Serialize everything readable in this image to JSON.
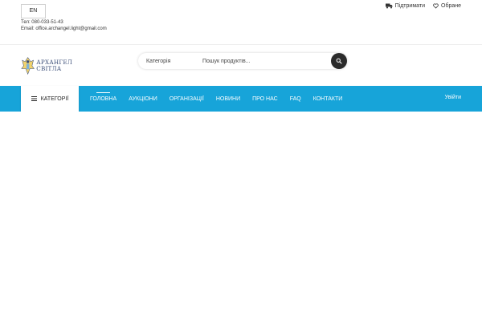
{
  "topbar": {
    "lang_button": "EN",
    "phone": "Тел: 080-033-51-43",
    "email": "Email: office.archangel.light@gmail.com",
    "support_label": "Підтримати",
    "favorites_label": "Обране"
  },
  "header": {
    "logo_line1": "АРХАНГЕЛ",
    "logo_line2": "СВІТЛА",
    "search": {
      "category_label": "Категорія",
      "placeholder": "Пошук продуктів..."
    }
  },
  "nav": {
    "categories_label": "КАТЕГОРІЇ",
    "items": [
      {
        "label": "ГОЛОВНА"
      },
      {
        "label": "АУКЦІОНИ"
      },
      {
        "label": "ОРГАНІЗАЦІЇ"
      },
      {
        "label": "НОВИНИ"
      },
      {
        "label": "ПРО НАС"
      },
      {
        "label": "FAQ"
      },
      {
        "label": "КОНТАКТИ"
      }
    ],
    "login_label": "Увійти"
  },
  "colors": {
    "nav_background": "#17a4d9",
    "logo_text": "#3b4e78",
    "search_button": "#2b2b2b"
  },
  "icons": {
    "support": "truck-icon",
    "favorites": "heart-icon",
    "search": "search-icon",
    "categories": "hamburger-icon"
  }
}
